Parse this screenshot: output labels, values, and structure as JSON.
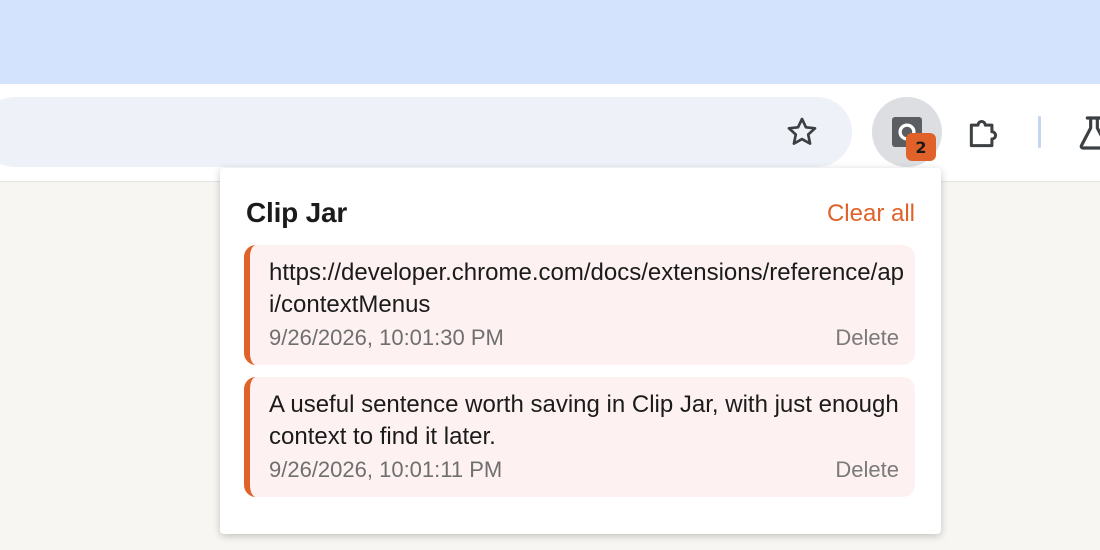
{
  "extension": {
    "badge_count": "2"
  },
  "popup": {
    "title": "Clip Jar",
    "clear_all_label": "Clear all",
    "clips": [
      {
        "text": "https://developer.chrome.com/docs/extensions/reference/api/contextMenus",
        "timestamp": "9/26/2026, 10:01:30 PM",
        "delete_label": "Delete"
      },
      {
        "text": "A useful sentence worth saving in Clip Jar, with just enough context to find it later.",
        "timestamp": "9/26/2026, 10:01:11 PM",
        "delete_label": "Delete"
      }
    ]
  },
  "colors": {
    "accent": "#e0622a",
    "tabstrip": "#d3e3fd",
    "clip_background": "#fdf2f1"
  },
  "icons": [
    "bookmark-star-icon",
    "clip-jar-extension-icon",
    "extensions-puzzle-icon",
    "labs-flask-icon"
  ]
}
